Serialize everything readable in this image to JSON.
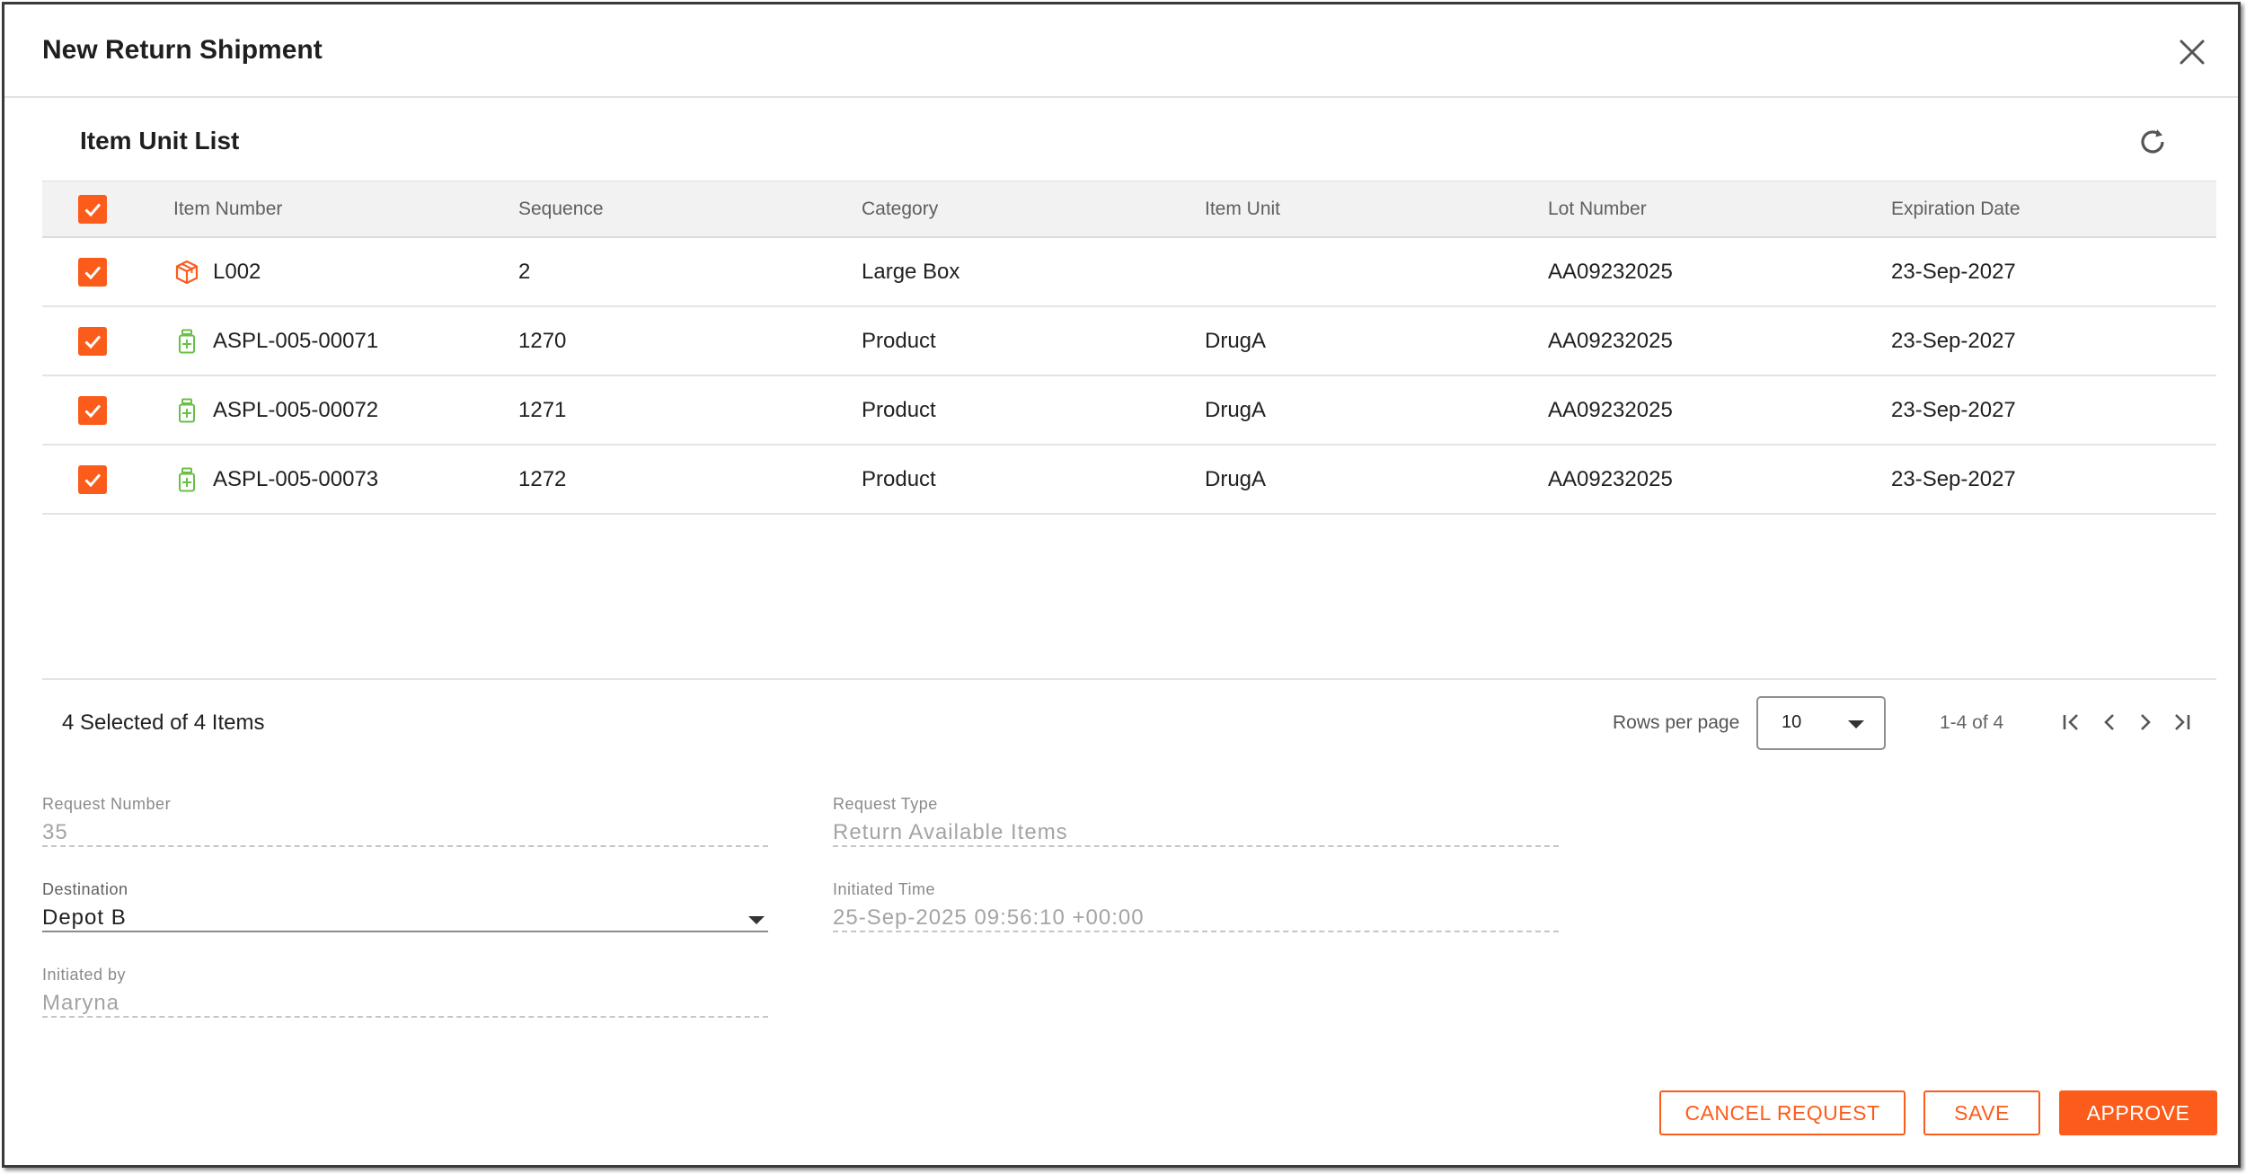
{
  "dialog": {
    "title": "New Return Shipment",
    "close_icon": "close-icon"
  },
  "section": {
    "title": "Item Unit List",
    "refresh_icon": "refresh-icon"
  },
  "table": {
    "headers": {
      "item_number": "Item Number",
      "sequence": "Sequence",
      "category": "Category",
      "item_unit": "Item Unit",
      "lot_number": "Lot Number",
      "expiration_date": "Expiration Date"
    },
    "rows": [
      {
        "checked": true,
        "icon": "box-icon",
        "item_number": "L002",
        "sequence": "2",
        "category": "Large Box",
        "item_unit": "",
        "lot_number": "AA09232025",
        "expiration_date": "23-Sep-2027"
      },
      {
        "checked": true,
        "icon": "medicine-bottle-icon",
        "item_number": "ASPL-005-00071",
        "sequence": "1270",
        "category": "Product",
        "item_unit": "DrugA",
        "lot_number": "AA09232025",
        "expiration_date": "23-Sep-2027"
      },
      {
        "checked": true,
        "icon": "medicine-bottle-icon",
        "item_number": "ASPL-005-00072",
        "sequence": "1271",
        "category": "Product",
        "item_unit": "DrugA",
        "lot_number": "AA09232025",
        "expiration_date": "23-Sep-2027"
      },
      {
        "checked": true,
        "icon": "medicine-bottle-icon",
        "item_number": "ASPL-005-00073",
        "sequence": "1272",
        "category": "Product",
        "item_unit": "DrugA",
        "lot_number": "AA09232025",
        "expiration_date": "23-Sep-2027"
      }
    ],
    "footer": {
      "selected_text": "4 Selected of 4 Items",
      "rows_per_page_label": "Rows per page",
      "rows_per_page_value": "10",
      "range_text": "1-4 of 4"
    }
  },
  "form": {
    "request_number": {
      "label": "Request Number",
      "value": "35"
    },
    "request_type": {
      "label": "Request Type",
      "value": "Return Available Items"
    },
    "destination": {
      "label": "Destination",
      "value": "Depot B"
    },
    "initiated_time": {
      "label": "Initiated Time",
      "value": "25-Sep-2025 09:56:10 +00:00"
    },
    "initiated_by": {
      "label": "Initiated by",
      "value": "Maryna"
    }
  },
  "actions": {
    "cancel_label": "CANCEL REQUEST",
    "save_label": "SAVE",
    "approve_label": "APPROVE"
  },
  "colors": {
    "accent": "#fc5c1b",
    "product_icon": "#6abf45"
  }
}
